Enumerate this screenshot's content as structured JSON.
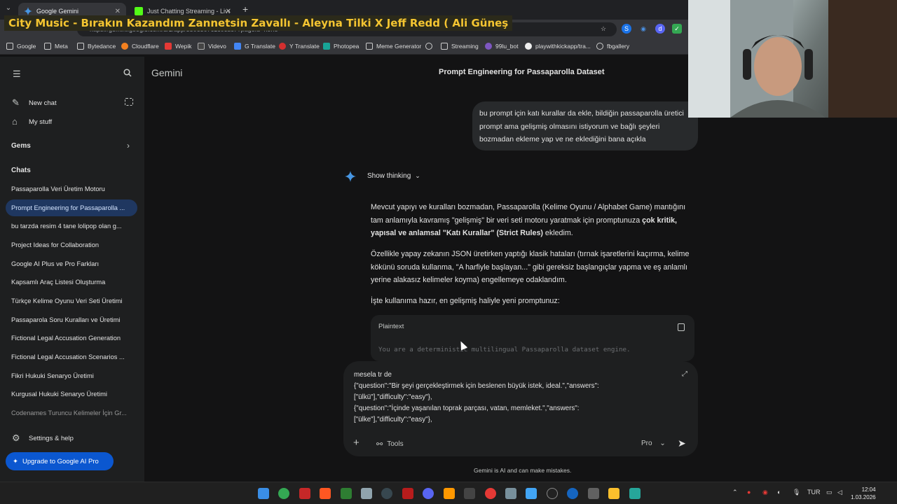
{
  "browser": {
    "tabs": [
      {
        "label": "Google Gemini",
        "active": true
      },
      {
        "label": "Just Chatting Streaming - Live",
        "active": false
      }
    ],
    "url": "https://gemini.google.com/u/1/app/5506507c1c0cdc7?pageId=none",
    "bookmarks": [
      "Google",
      "Meta",
      "Bytedance",
      "Cloudflare",
      "Wepik",
      "Videvo",
      "G Translate",
      "Y Translate",
      "Photopea",
      "Meme Generator",
      "Streaming",
      "99lu_bot",
      "playwithkickapp/tra...",
      "fbgallery"
    ]
  },
  "overlay": {
    "now_playing": "City Music - Bırakın Kazandım Zannetsin Zavallı - Aleyna Tilki X Jeff Redd ( Ali Güneş"
  },
  "sidebar": {
    "new_chat": "New chat",
    "my_stuff": "My stuff",
    "gems": "Gems",
    "chats_heading": "Chats",
    "chats": [
      "Passaparolla Veri Üretim Motoru",
      "Prompt Engineering for Passaparolla ...",
      "bu tarzda resim 4 tane lolipop olan g...",
      "Project Ideas for Collaboration",
      "Google AI Plus ve Pro Farkları",
      "Kapsamlı Araç Listesi Oluşturma",
      "Türkçe Kelime Oyunu Veri Seti Üretimi",
      "Passaparola Soru Kuralları ve Üretimi",
      "Fictional Legal Accusation Generation",
      "Fictional Legal Accusation Scenarios ...",
      "Fikri Hukuki Senaryo Üretimi",
      "Kurgusal Hukuki Senaryo Üretimi",
      "Codenames Turuncu Kelimeler İçin Gr..."
    ],
    "settings": "Settings & help",
    "upgrade": "Upgrade to Google AI Pro"
  },
  "page": {
    "brand": "Gemini",
    "title": "Prompt Engineering for Passaparolla Dataset"
  },
  "conversation": {
    "user_message": "bu prompt için katı kurallar da ekle, bildiğin passaparolla üretici prompt ama gelişmiş olmasını istiyorum ve bağlı şeyleri bozmadan ekleme yap ve ne eklediğini bana açıkla",
    "show_thinking": "Show thinking",
    "p1_a": "Mevcut yapıyı ve kuralları bozmadan, Passaparolla (Kelime Oyunu / Alphabet Game) mantığını tam anlamıyla kavramış \"gelişmiş\" bir veri seti motoru yaratmak için promptunuza ",
    "p1_b": "çok kritik, yapısal ve anlamsal \"Katı Kurallar\" (Strict Rules)",
    "p1_c": " ekledim.",
    "p2": "Özellikle yapay zekanın JSON üretirken yaptığı klasik hataları (tırnak işaretlerini kaçırma, kelime kökünü soruda kullanma, \"A harfiyle başlayan...\" gibi gereksiz başlangıçlar yapma ve eş anlamlı yerine alakasız kelimeler koyma) engellemeye odaklandım.",
    "p3": "İşte kullanıma hazır, en gelişmiş haliyle yeni promptunuz:",
    "code_lang": "Plaintext",
    "code_first_line": "You are a deterministic multilingual Passaparolla dataset engine."
  },
  "composer": {
    "text": "mesela tr de\n{\"question\":\"Bir şeyi gerçekleştirmek için beslenen büyük istek, ideal.\",\"answers\":\n[\"ülkü\"],\"difficulty\":\"easy\"},\n{\"question\":\"İçinde yaşanılan toprak parçası, vatan, memleket.\",\"answers\":\n[\"ülke\"],\"difficulty\":\"easy\"},",
    "tools": "Tools",
    "model": "Pro",
    "disclaimer": "Gemini is AI and can make mistakes."
  },
  "taskbar": {
    "lang": "TUR",
    "time": "12:04",
    "date": "1.03.2026"
  }
}
